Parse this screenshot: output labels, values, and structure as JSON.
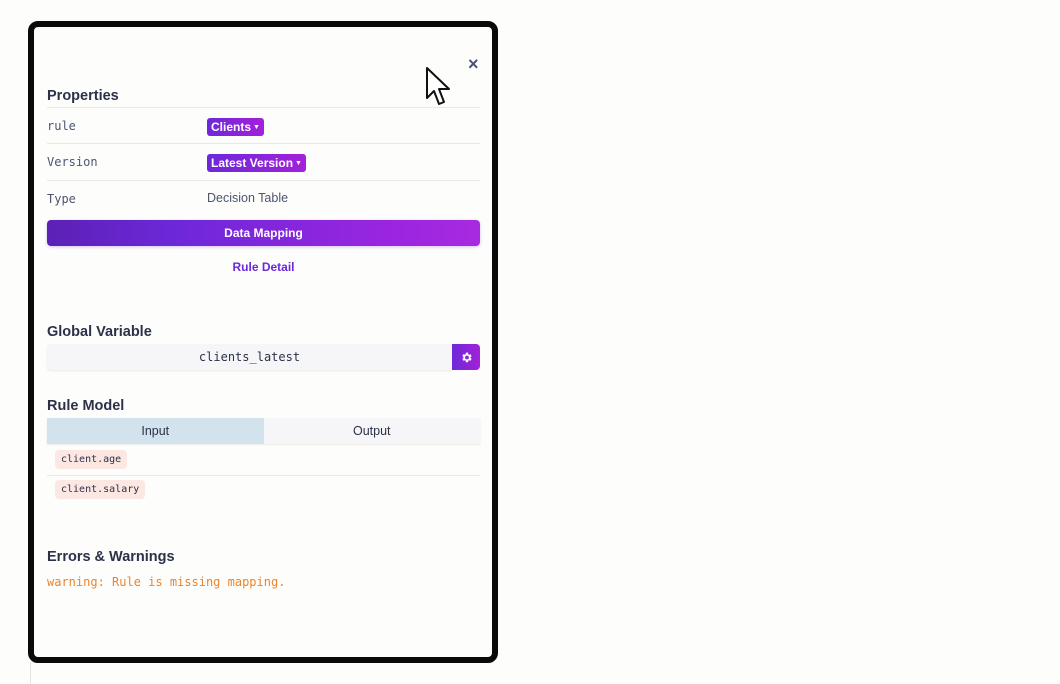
{
  "panel": {
    "close_icon": "close-icon",
    "close_glyph": "×"
  },
  "properties": {
    "title": "Properties",
    "rows": [
      {
        "label": "rule",
        "value": "Clients"
      },
      {
        "label": "Version",
        "value": "Latest Version"
      },
      {
        "label": "Type",
        "value": "Decision Table"
      }
    ],
    "data_mapping_label": "Data Mapping",
    "rule_detail_label": "Rule Detail"
  },
  "global_variable": {
    "title": "Global Variable",
    "value": "clients_latest",
    "settings_icon": "gear-icon"
  },
  "rule_model": {
    "title": "Rule Model",
    "tabs": [
      {
        "label": "Input",
        "active": true
      },
      {
        "label": "Output",
        "active": false
      }
    ],
    "inputs": [
      "client.age",
      "client.salary"
    ]
  },
  "errors": {
    "title": "Errors & Warnings",
    "messages": [
      "warning: Rule is missing mapping."
    ]
  },
  "colors": {
    "accent_start": "#6d28d9",
    "accent_end": "#a321d9",
    "warning": "#ee8327",
    "tab_active": "#d3e3ee",
    "chip_bg": "#fde7e2"
  }
}
